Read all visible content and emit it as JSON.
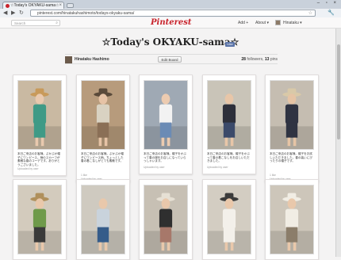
{
  "browser": {
    "tab_title": "☆Today's OKYAKU-sama☆",
    "tab_close": "×",
    "url": "pinterest.com/hinatakuhashimoto/todays-okyaku-sama/",
    "window_controls": "– ▫ ×",
    "back": "◀",
    "forward": "▶",
    "reload": "↻",
    "star": "☆",
    "menu": "🔧"
  },
  "header": {
    "search_placeholder": "Search",
    "logo": "Pinterest",
    "add_label": "Add +",
    "about_label": "About ▾",
    "user_label": "Hinataku ▾"
  },
  "board": {
    "title": "☆Today's OKYAKU-sama☆",
    "like_label": "Like",
    "owner_name": "Hinataku Hashimo",
    "edit_label": "Edit Board",
    "followers": "28",
    "followers_label": "followers,",
    "pins": "13",
    "pins_label": "pins"
  },
  "pins": [
    {
      "desc": "本日ご来店のお客様。ぷかぷか帽子にワンピース。柄のスカーフが素敵な春のコーデです。ありがとうございました。",
      "meta": "Uploaded by user",
      "photo": "green-dress"
    },
    {
      "desc": "本日ご来店のお客様。ぷかぷか帽子にワンピース柄。ちょっとした春の着こなしがとても素敵です。",
      "meta": "1 like",
      "via": "Uploaded by user",
      "photo": "book-hat"
    },
    {
      "desc": "本日ご来店のお客様。帽子をかぶって春の服をお召しになっていらっしゃいます。",
      "meta": "Uploaded by user",
      "photo": "apron-dress"
    },
    {
      "desc": "本日ご来店のお客様。帽子をかぶって春の着こなしをお召しいただきました。",
      "meta": "Uploaded by user",
      "photo": "dark-coat"
    },
    {
      "desc": "本日ご来店のお客様。帽子をお試しいただきました。春の装いにぴったりの帽子です。",
      "meta": "1 like",
      "via": "Uploaded by user",
      "photo": "coat-hat"
    },
    {
      "desc": "",
      "meta": "",
      "photo": "green-top"
    },
    {
      "desc": "",
      "meta": "",
      "photo": "stripe-top"
    },
    {
      "desc": "",
      "meta": "",
      "photo": "checked-skirt"
    },
    {
      "desc": "",
      "meta": "",
      "photo": "white-dress"
    },
    {
      "desc": "",
      "meta": "",
      "photo": "white-hat"
    }
  ],
  "colors": {
    "brand": "#c8232c",
    "background": "#f4f3f3"
  }
}
